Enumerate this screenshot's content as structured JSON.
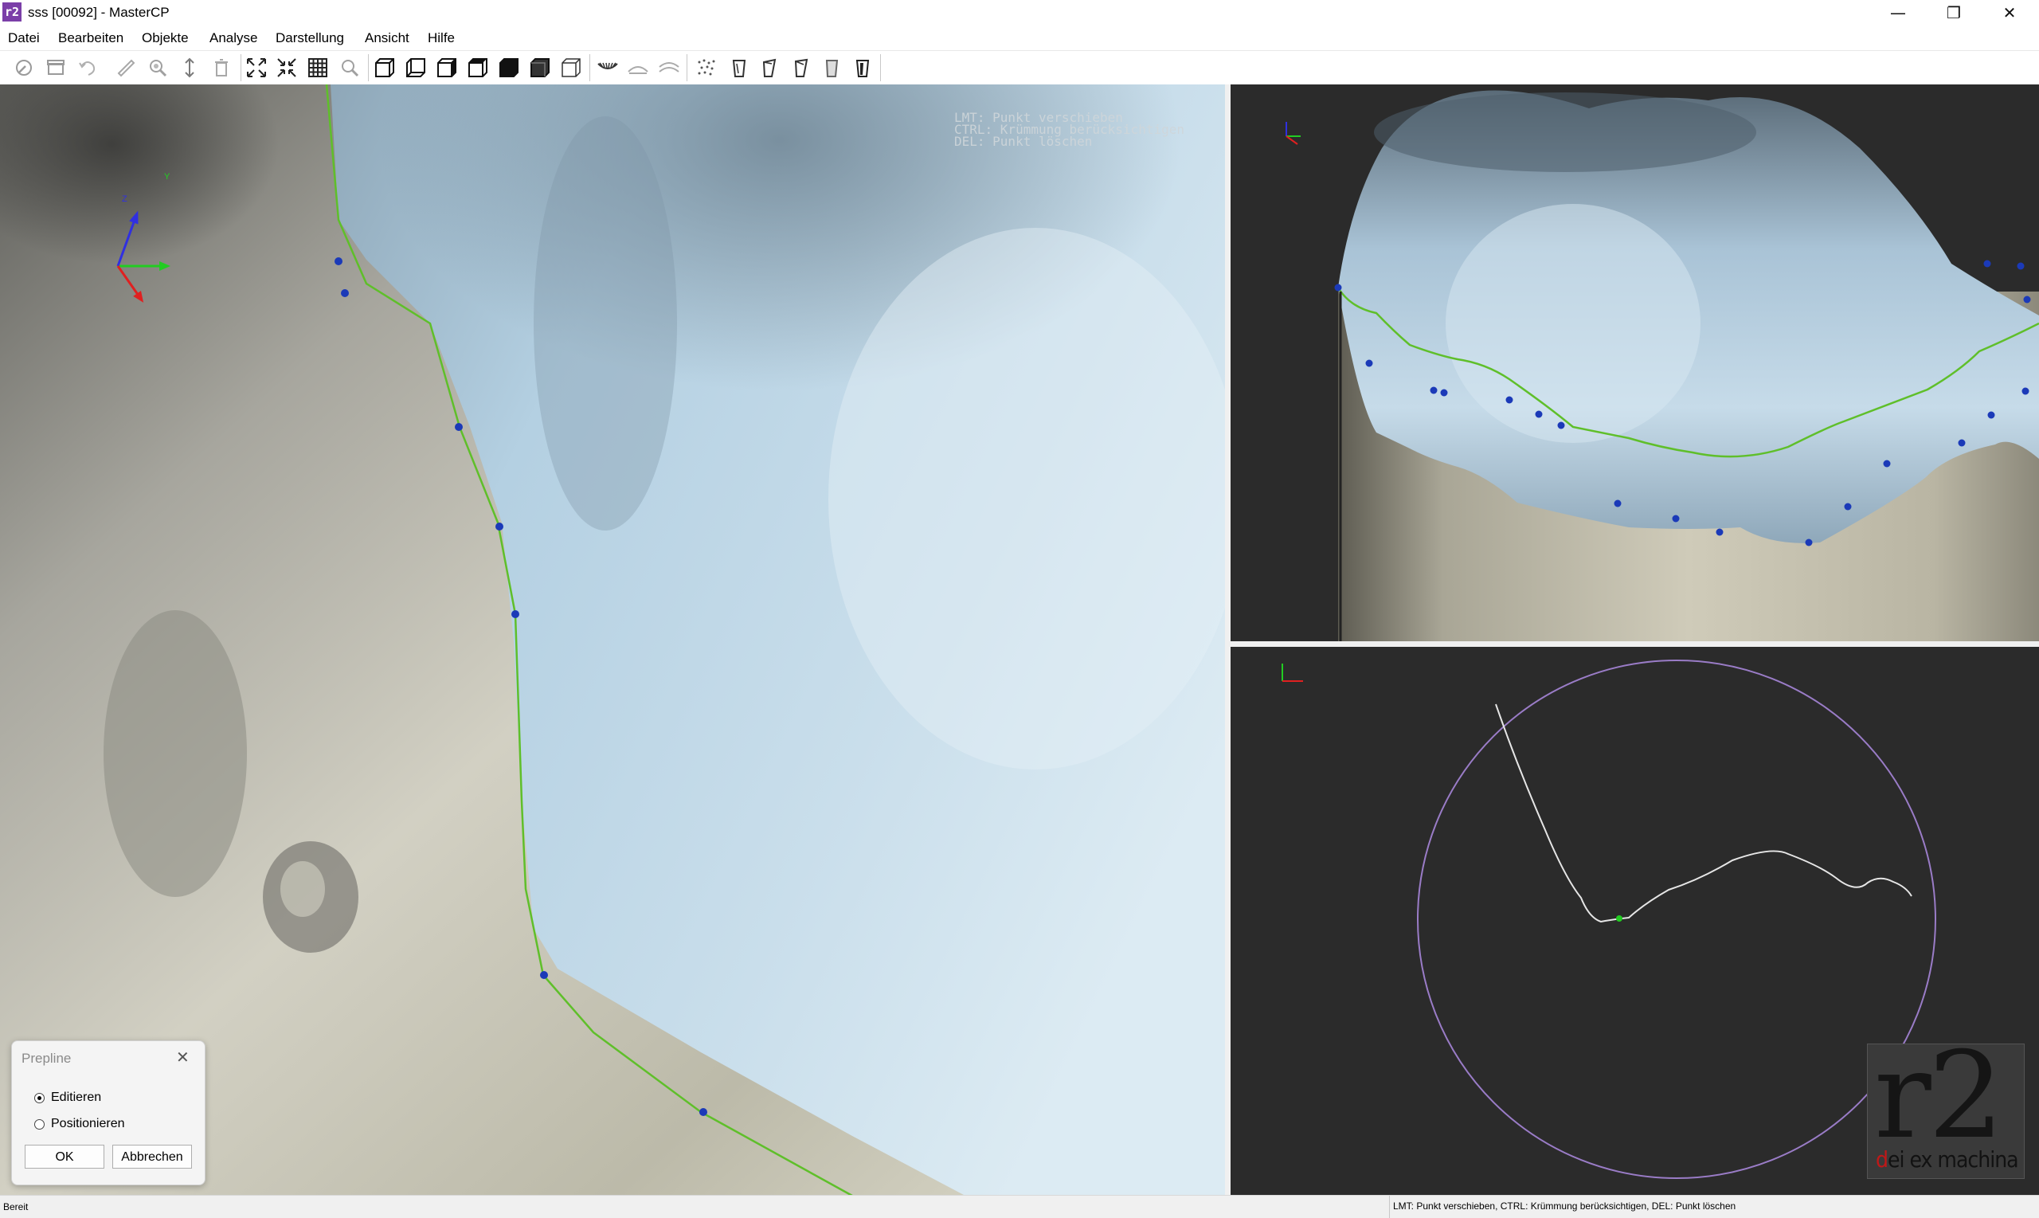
{
  "window": {
    "title": "sss [00092] - MasterCP",
    "app_icon_text": "r2",
    "minimize": "—",
    "restore": "❐",
    "close": "✕"
  },
  "menu": [
    "Datei",
    "Bearbeiten",
    "Objekte",
    "Analyse",
    "Darstellung",
    "Ansicht",
    "Hilfe"
  ],
  "toolbar": {
    "groups": [
      [
        "wrench-icon",
        "box-icon",
        "undo-icon",
        "ruler-icon",
        "zoom-lens-icon",
        "vertical-arrow-icon",
        "trash-icon"
      ],
      [
        "expand-icon",
        "collapse-icon",
        "grid-icon",
        "search-icon"
      ],
      [
        "cube-front-icon",
        "cube-back-icon",
        "cube-left-icon",
        "cube-right-icon",
        "cube-solid-icon",
        "cube-dark-icon",
        "cube-outline-icon"
      ],
      [
        "upper-jaw-icon",
        "lower-jaw-icon",
        "jaw-arch-icon"
      ],
      [
        "point-cloud-icon",
        "tooth-1-icon",
        "tooth-2-icon",
        "tooth-3-icon",
        "tooth-4-icon",
        "tooth-5-icon"
      ]
    ]
  },
  "viewport_hint": "LMT: Punkt verschieben\nCTRL: Krümmung berücksichtigen\nDEL: Punkt löschen",
  "axes": {
    "z": "Z",
    "y": "Y",
    "x": "X"
  },
  "dialog": {
    "title": "Prepline",
    "options": [
      {
        "label": "Editieren",
        "selected": true
      },
      {
        "label": "Positionieren",
        "selected": false
      }
    ],
    "ok": "OK",
    "cancel": "Abbrechen"
  },
  "logo": {
    "r2": "r2",
    "d": "d",
    "rest": "ei ex machina"
  },
  "status": {
    "left": "Bereit",
    "right": "LMT: Punkt verschieben, CTRL: Krümmung berücksichtigen, DEL: Punkt löschen"
  },
  "colors": {
    "prepline": "#5fbf2a",
    "control_point": "#1b3ab8",
    "crown": "#a8c4d6",
    "gingiva": "#c9c6b6",
    "circle": "#9a7cc7"
  }
}
